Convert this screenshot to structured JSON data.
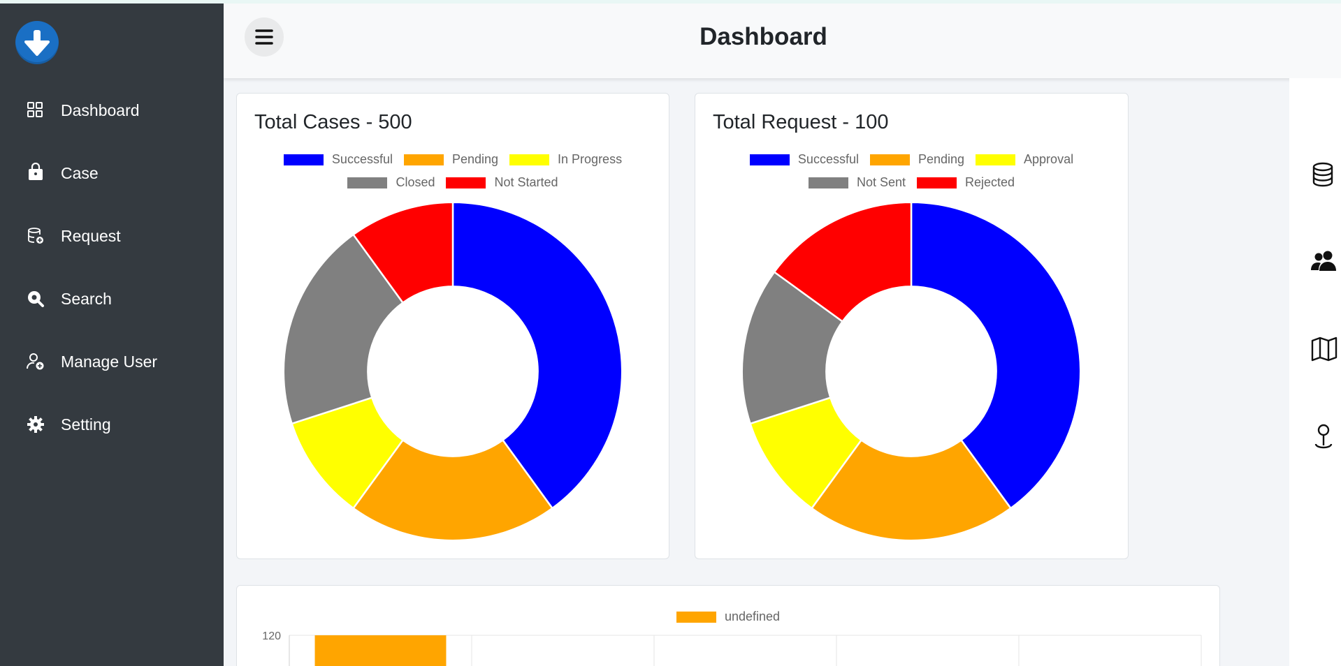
{
  "header": {
    "title": "Dashboard"
  },
  "sidebar": {
    "items": [
      {
        "label": "Dashboard",
        "icon": "grid-icon"
      },
      {
        "label": "Case",
        "icon": "briefcase-icon"
      },
      {
        "label": "Request",
        "icon": "database-add-icon"
      },
      {
        "label": "Search",
        "icon": "search-icon"
      },
      {
        "label": "Manage User",
        "icon": "user-add-icon"
      },
      {
        "label": "Setting",
        "icon": "gear-icon"
      }
    ]
  },
  "right_bar": {
    "icons": [
      "database-icon",
      "people-icon",
      "map-icon",
      "pin-icon"
    ]
  },
  "colors": {
    "sidebar": "#343a40",
    "blue": "#0000ff",
    "orange": "#ffa500",
    "yellow": "#ffff00",
    "gray": "#808080",
    "red": "#ff0000"
  },
  "cards": {
    "cases": {
      "title": "Total Cases - 500"
    },
    "requests": {
      "title": "Total Request - 100"
    },
    "bar": {}
  },
  "chart_data": [
    {
      "type": "pie",
      "title": "Total Cases - 500",
      "categories": [
        "Successful",
        "Pending",
        "In Progress",
        "Closed",
        "Not Started"
      ],
      "values": [
        200,
        100,
        50,
        100,
        50
      ],
      "colors": [
        "#0000ff",
        "#ffa500",
        "#ffff00",
        "#808080",
        "#ff0000"
      ],
      "legend": "top"
    },
    {
      "type": "pie",
      "title": "Total Request - 100",
      "categories": [
        "Successful",
        "Pending",
        "Approval",
        "Not Sent",
        "Rejected"
      ],
      "values": [
        40,
        20,
        10,
        15,
        15
      ],
      "colors": [
        "#0000ff",
        "#ffa500",
        "#ffff00",
        "#808080",
        "#ff0000"
      ],
      "legend": "top"
    },
    {
      "type": "bar",
      "series": [
        {
          "name": "undefined",
          "values": [
            120,
            null,
            null,
            null,
            null
          ],
          "color": "#ffa500"
        }
      ],
      "yticks": [
        120
      ],
      "ylim": [
        0,
        120
      ],
      "grid": true,
      "legend": "top"
    }
  ]
}
